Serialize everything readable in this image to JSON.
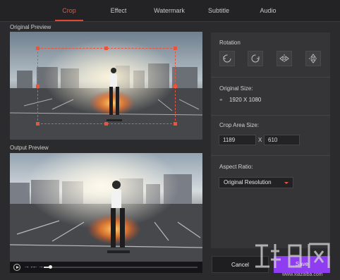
{
  "tabs": [
    {
      "label": "Crop",
      "active": true
    },
    {
      "label": "Effect",
      "active": false
    },
    {
      "label": "Watermark",
      "active": false
    },
    {
      "label": "Subtitle",
      "active": false
    },
    {
      "label": "Audio",
      "active": false
    }
  ],
  "original_preview": {
    "label": "Original Preview"
  },
  "output_preview": {
    "label": "Output Preview"
  },
  "player": {
    "progress_fraction": 0.04
  },
  "rotation": {
    "title": "Rotation"
  },
  "original_size": {
    "title": "Original Size:",
    "value": "1920 X 1080"
  },
  "crop_area": {
    "title": "Crop Area Size:",
    "width": "1189",
    "separator": "X",
    "height": "610"
  },
  "aspect_ratio": {
    "title": "Aspect Ratio:",
    "selected": "Original Resolution"
  },
  "buttons": {
    "cancel": "Cancel",
    "save": "Save"
  },
  "watermark": {
    "text": "www.xiazaiba.com"
  },
  "colors": {
    "accent": "#e2482f",
    "save": "#8e3df0",
    "background": "#2b2b2d",
    "panel": "#353537"
  }
}
